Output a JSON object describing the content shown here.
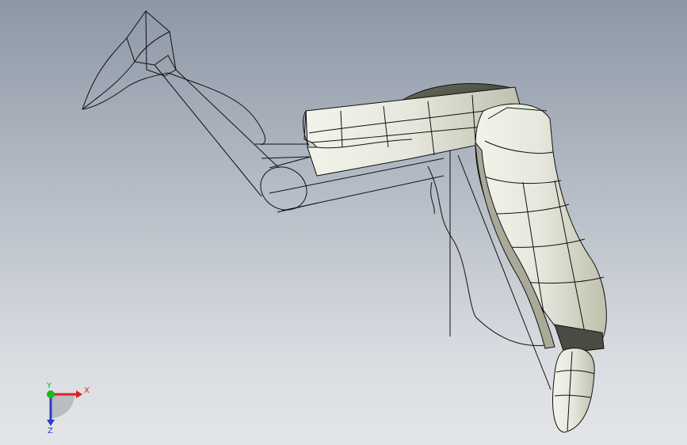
{
  "viewport": {
    "background_top": "#8d97a6",
    "background_bottom": "#e3e5e8",
    "model_fill": "#e3e4d9",
    "model_shadow": "#b8b9a6",
    "edge_color": "#111111"
  },
  "triad": {
    "x_label": "X",
    "y_label": "Y",
    "z_label": "Z",
    "x_color": "#e0201c",
    "y_color": "#1cb81c",
    "z_color": "#2a3cc8"
  }
}
